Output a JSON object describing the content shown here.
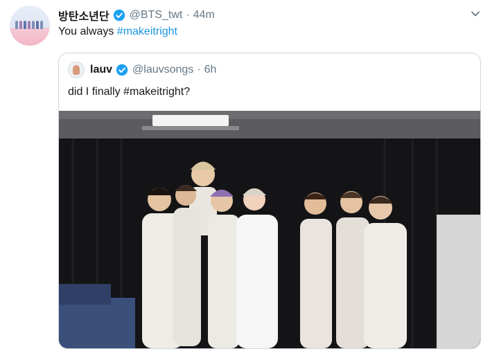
{
  "tweet": {
    "display_name": "방탄소년단",
    "handle": "@BTS_twt",
    "separator": "·",
    "time": "44m",
    "text_prefix": "You always ",
    "hashtag": "#makeitright",
    "verified_color": "#1da1f2",
    "link_color": "#1b95e0"
  },
  "quoted_tweet": {
    "display_name": "lauv",
    "handle": "@lauvsongs",
    "separator": "·",
    "time": "6h",
    "text": "did I finally #makeitright?"
  },
  "photo": {
    "description_icon": "group-photo"
  }
}
